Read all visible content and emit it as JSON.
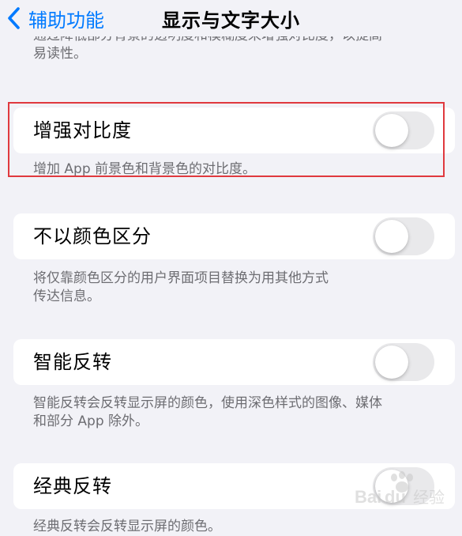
{
  "nav": {
    "back_label": "辅助功能",
    "title": "显示与文字大小"
  },
  "top_footer": {
    "line1": "通过降低部分背景的透明度和模糊度来增强对比度，以提高",
    "line2": "易读性。"
  },
  "settings": [
    {
      "label": "增强对比度",
      "enabled": false,
      "footer": [
        "增加 App 前景色和背景色的对比度。"
      ]
    },
    {
      "label": "不以颜色区分",
      "enabled": false,
      "footer": [
        "将仅靠颜色区分的用户界面项目替换为用其他方式",
        "传达信息。"
      ]
    },
    {
      "label": "智能反转",
      "enabled": false,
      "footer": [
        "智能反转会反转显示屏的颜色，使用深色样式的图像、媒体",
        "和部分 App 除外。"
      ]
    },
    {
      "label": "经典反转",
      "enabled": false,
      "footer": [
        "经典反转会反转显示屏的颜色。"
      ]
    }
  ],
  "watermark": {
    "brand": "Bai",
    "brand_suffix": "经验"
  },
  "colors": {
    "accent": "#007aff",
    "highlight": "#e0393e",
    "toggle_off": "#e9e9eb",
    "background": "#f2f2f7"
  },
  "icons": {
    "back": "chevron-left-icon",
    "watermark": "paw-icon"
  }
}
